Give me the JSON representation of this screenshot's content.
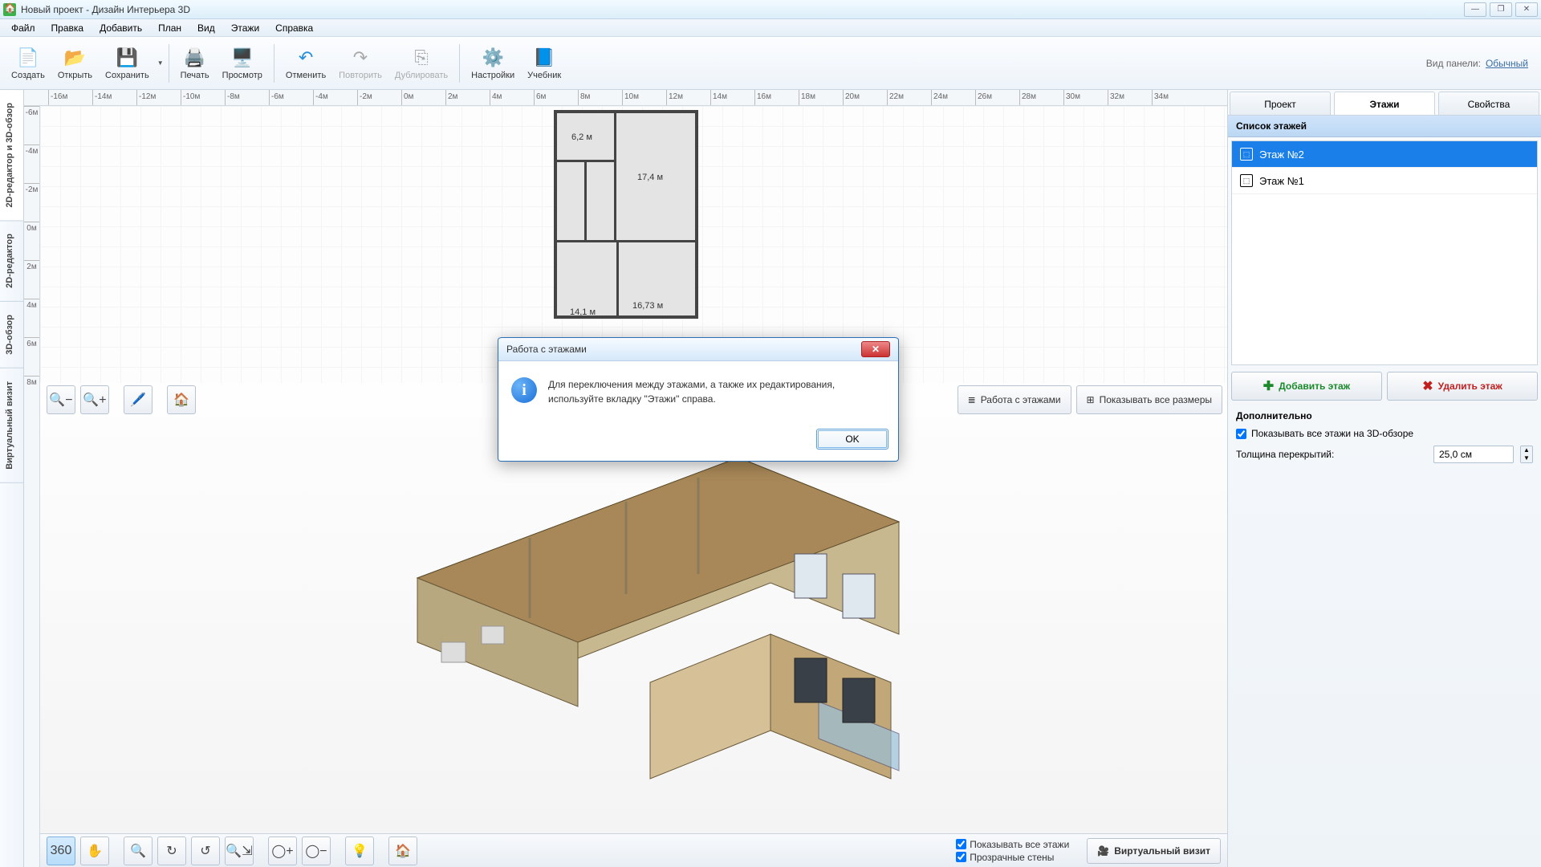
{
  "app": {
    "title": "Новый проект - Дизайн Интерьера 3D"
  },
  "menu": {
    "file": "Файл",
    "edit": "Правка",
    "add": "Добавить",
    "plan": "План",
    "view": "Вид",
    "floors": "Этажи",
    "help": "Справка"
  },
  "toolbar": {
    "create": "Создать",
    "open": "Открыть",
    "save": "Сохранить",
    "print": "Печать",
    "preview": "Просмотр",
    "undo": "Отменить",
    "redo": "Повторить",
    "duplicate": "Дублировать",
    "settings": "Настройки",
    "tutorial": "Учебник",
    "panel_type_label": "Вид панели:",
    "panel_type_value": "Обычный"
  },
  "left_tabs": {
    "t1": "2D-редактор и 3D-обзор",
    "t2": "2D-редактор",
    "t3": "3D-обзор",
    "t4": "Виртуальный визит"
  },
  "ruler_h": [
    "-16м",
    "-14м",
    "-12м",
    "-10м",
    "-8м",
    "-6м",
    "-4м",
    "-2м",
    "0м",
    "2м",
    "4м",
    "6м",
    "8м",
    "10м",
    "12м",
    "14м",
    "16м",
    "18м",
    "20м",
    "22м",
    "24м",
    "26м",
    "28м",
    "30м",
    "32м",
    "34м"
  ],
  "ruler_v": [
    "-6м",
    "-4м",
    "-2м",
    "0м",
    "2м",
    "4м",
    "6м",
    "8м"
  ],
  "rooms": {
    "r1": "6,2 м",
    "r2": "17,4 м",
    "r3": "14,1 м",
    "r4": "16,73 м"
  },
  "mid_buttons": {
    "floors_work": "Работа с этажами",
    "show_all_dims": "Показывать все размеры"
  },
  "bottom": {
    "show_all_floors": "Показывать все этажи",
    "transparent_walls": "Прозрачные стены",
    "virtual_visit": "Виртуальный визит"
  },
  "right": {
    "tab_project": "Проект",
    "tab_floors": "Этажи",
    "tab_props": "Свойства",
    "list_header": "Список этажей",
    "floors": [
      {
        "label": "Этаж №2",
        "selected": true
      },
      {
        "label": "Этаж №1",
        "selected": false
      }
    ],
    "add_floor": "Добавить этаж",
    "delete_floor": "Удалить этаж",
    "additional": "Дополнительно",
    "show_all_3d": "Показывать все этажи на 3D-обзоре",
    "thickness_label": "Толщина перекрытий:",
    "thickness_value": "25,0 см"
  },
  "dialog": {
    "title": "Работа с этажами",
    "text": "Для переключения между этажами, а также их редактирования, используйте вкладку \"Этажи\" справа.",
    "ok": "OK"
  }
}
